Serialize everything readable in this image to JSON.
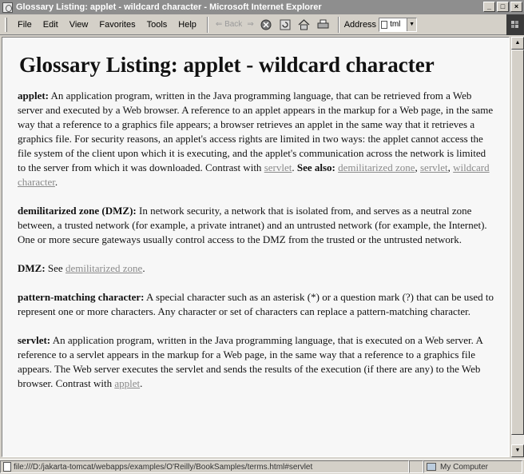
{
  "window": {
    "title": "Glossary Listing: applet - wildcard character - Microsoft Internet Explorer",
    "minimize": "_",
    "maximize": "□",
    "close": "×"
  },
  "menu": [
    "File",
    "Edit",
    "View",
    "Favorites",
    "Tools",
    "Help"
  ],
  "toolbar": {
    "back_label": "⇐ Back",
    "forward_symbol": "⇒",
    "address_label": "Address",
    "address_value": "tml"
  },
  "page": {
    "heading": "Glossary Listing: applet - wildcard character",
    "applet": {
      "term": "applet:",
      "definition": "An application program, written in the Java programming language, that can be retrieved from a Web server and executed by a Web browser. A reference to an applet appears in the markup for a Web page, in the same way that a reference to a graphics file appears; a browser retrieves an applet in the same way that it retrieves a graphics file. For security reasons, an applet's access rights are limited in two ways: the applet cannot access the file system of the client upon which it is executing, and the applet's communication across the network is limited to the server from which it was downloaded. Contrast with",
      "contrast_link": "servlet",
      "see_also_label": "See also:",
      "see_also_links": [
        "demilitarized zone",
        "servlet",
        "wildcard character"
      ]
    },
    "dmz_full": {
      "term": "demilitarized zone (DMZ):",
      "definition": "In network security, a network that is isolated from, and serves as a neutral zone between, a trusted network (for example, a private intranet) and an untrusted network (for example, the Internet). One or more secure gateways usually control access to the DMZ from the trusted or the untrusted network."
    },
    "dmz_short": {
      "term": "DMZ:",
      "see_label": "See",
      "link": "demilitarized zone"
    },
    "pattern": {
      "term": "pattern-matching character:",
      "definition": "A special character such as an asterisk (*) or a question mark (?) that can be used to represent one or more characters. Any character or set of characters can replace a pattern-matching character."
    },
    "servlet": {
      "term": "servlet:",
      "definition": "An application program, written in the Java programming language, that is executed on a Web server. A reference to a servlet appears in the markup for a Web page, in the same way that a reference to a graphics file appears. The Web server executes the servlet and sends the results of the execution (if there are any) to the Web browser. Contrast with",
      "contrast_link": "applet"
    }
  },
  "status": {
    "url": "file:///D:/jakarta-tomcat/webapps/examples/O'Reilly/BookSamples/terms.html#servlet",
    "zone": "My Computer"
  },
  "icons": [
    "ie-page-icon",
    "stop-icon",
    "refresh-icon",
    "home-icon",
    "print-icon",
    "windows-logo-icon",
    "my-computer-icon"
  ]
}
